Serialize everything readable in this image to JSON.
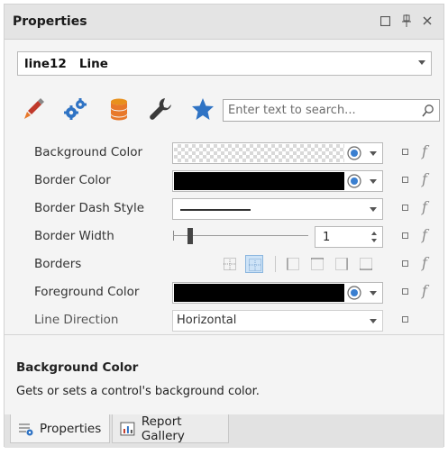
{
  "panel": {
    "title": "Properties",
    "buttons": [
      "maximize-icon",
      "pin-icon",
      "close-icon"
    ]
  },
  "selector": {
    "value": "line12   Line"
  },
  "toolbar": {
    "tools": [
      "brush-icon",
      "gears-icon",
      "database-icon",
      "wrench-icon",
      "star-icon"
    ],
    "search_placeholder": "Enter text to search..."
  },
  "properties": [
    {
      "label": "Background Color",
      "editor": "color",
      "value_color": "transparent"
    },
    {
      "label": "Border Color",
      "editor": "color",
      "value_color": "#000000"
    },
    {
      "label": "Border Dash Style",
      "editor": "dash",
      "value": "Solid"
    },
    {
      "label": "Border Width",
      "editor": "slider-spin",
      "value": "1"
    },
    {
      "label": "Borders",
      "editor": "borders"
    },
    {
      "label": "Foreground Color",
      "editor": "color",
      "value_color": "#000000"
    },
    {
      "label": "Line Direction",
      "editor": "dropdown",
      "value": "Horizontal"
    }
  ],
  "description": {
    "title": "Background Color",
    "text": "Gets or sets a control's background color."
  },
  "tabs": [
    {
      "label": "Properties",
      "active": true
    },
    {
      "label": "Report Gallery",
      "active": false
    }
  ],
  "colors": {
    "accent_orange": "#e8782a",
    "accent_blue": "#2f73c4",
    "selected_blue": "#cde3f7"
  }
}
